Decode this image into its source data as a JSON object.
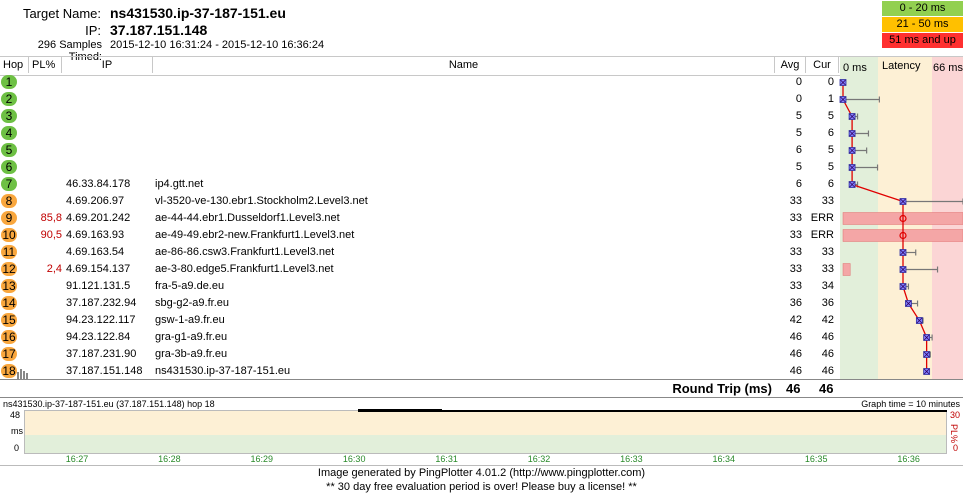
{
  "header": {
    "target_label": "Target Name:",
    "target_value": "ns431530.ip-37-187-151.eu",
    "ip_label": "IP:",
    "ip_value": "37.187.151.148",
    "samples_label": "296 Samples Timed:",
    "samples_value": "2015-12-10 16:31:24 - 2015-12-10 16:36:24"
  },
  "legend": [
    {
      "label": "0 - 20 ms",
      "color": "#92d050"
    },
    {
      "label": "21 - 50 ms",
      "color": "#ffc000"
    },
    {
      "label": "51 ms and up",
      "color": "#ff3030"
    }
  ],
  "columns": {
    "hop": "Hop",
    "pl": "PL%",
    "ip": "IP",
    "name": "Name",
    "avg": "Avg",
    "cur": "Cur",
    "graph_min": "0 ms",
    "graph_title": "Latency",
    "graph_max": "66 ms"
  },
  "hops": [
    {
      "hop": "1",
      "pl": "",
      "ip": "",
      "name": "",
      "avg": "0",
      "cur": "0",
      "color": "#6ec044",
      "lat": 0,
      "err_lo": 0,
      "err_hi": 1
    },
    {
      "hop": "2",
      "pl": "",
      "ip": "",
      "name": "",
      "avg": "0",
      "cur": "1",
      "color": "#6ec044",
      "lat": 0,
      "err_lo": 0,
      "err_hi": 20
    },
    {
      "hop": "3",
      "pl": "",
      "ip": "",
      "name": "",
      "avg": "5",
      "cur": "5",
      "color": "#6ec044",
      "lat": 5,
      "err_lo": 4,
      "err_hi": 8
    },
    {
      "hop": "4",
      "pl": "",
      "ip": "",
      "name": "",
      "avg": "5",
      "cur": "6",
      "color": "#6ec044",
      "lat": 5,
      "err_lo": 4,
      "err_hi": 14
    },
    {
      "hop": "5",
      "pl": "",
      "ip": "",
      "name": "",
      "avg": "6",
      "cur": "5",
      "color": "#6ec044",
      "lat": 5,
      "err_lo": 4,
      "err_hi": 13
    },
    {
      "hop": "6",
      "pl": "",
      "ip": "",
      "name": "",
      "avg": "5",
      "cur": "5",
      "color": "#6ec044",
      "lat": 5,
      "err_lo": 4,
      "err_hi": 19
    },
    {
      "hop": "7",
      "pl": "",
      "ip": "46.33.84.178",
      "name": "ip4.gtt.net",
      "avg": "6",
      "cur": "6",
      "color": "#6ec044",
      "lat": 5,
      "err_lo": 4,
      "err_hi": 8
    },
    {
      "hop": "8",
      "pl": "",
      "ip": "4.69.206.97",
      "name": "vl-3520-ve-130.ebr1.Stockholm2.Level3.net",
      "avg": "33",
      "cur": "33",
      "color": "#f9a73e",
      "lat": 33,
      "err_lo": 32,
      "err_hi": 66
    },
    {
      "hop": "9",
      "pl": "85,8",
      "ip": "4.69.201.242",
      "name": "ae-44-44.ebr1.Dusseldorf1.Level3.net",
      "avg": "33",
      "cur": "ERR",
      "color": "#f9a73e",
      "lat": 33,
      "err_lo": 33,
      "err_hi": 33,
      "loss": 1
    },
    {
      "hop": "10",
      "pl": "90,5",
      "ip": "4.69.163.93",
      "name": "ae-49-49.ebr2-new.Frankfurt1.Level3.net",
      "avg": "33",
      "cur": "ERR",
      "color": "#f9a73e",
      "lat": 33,
      "err_lo": 33,
      "err_hi": 33,
      "loss": 1
    },
    {
      "hop": "11",
      "pl": "",
      "ip": "4.69.163.54",
      "name": "ae-86-86.csw3.Frankfurt1.Level3.net",
      "avg": "33",
      "cur": "33",
      "color": "#f9a73e",
      "lat": 33,
      "err_lo": 32,
      "err_hi": 40
    },
    {
      "hop": "12",
      "pl": "2,4",
      "ip": "4.69.154.137",
      "name": "ae-3-80.edge5.Frankfurt1.Level3.net",
      "avg": "33",
      "cur": "33",
      "color": "#f9a73e",
      "lat": 33,
      "err_lo": 32,
      "err_hi": 52,
      "loss": 0.06
    },
    {
      "hop": "13",
      "pl": "",
      "ip": "91.121.131.5",
      "name": "fra-5-a9.de.eu",
      "avg": "33",
      "cur": "34",
      "color": "#f9a73e",
      "lat": 33,
      "err_lo": 32,
      "err_hi": 36
    },
    {
      "hop": "14",
      "pl": "",
      "ip": "37.187.232.94",
      "name": "sbg-g2-a9.fr.eu",
      "avg": "36",
      "cur": "36",
      "color": "#f9a73e",
      "lat": 36,
      "err_lo": 35,
      "err_hi": 41
    },
    {
      "hop": "15",
      "pl": "",
      "ip": "94.23.122.117",
      "name": "gsw-1-a9.fr.eu",
      "avg": "42",
      "cur": "42",
      "color": "#f9a73e",
      "lat": 42,
      "err_lo": 41,
      "err_hi": 44
    },
    {
      "hop": "16",
      "pl": "",
      "ip": "94.23.122.84",
      "name": "gra-g1-a9.fr.eu",
      "avg": "46",
      "cur": "46",
      "color": "#f9a73e",
      "lat": 46,
      "err_lo": 45,
      "err_hi": 49
    },
    {
      "hop": "17",
      "pl": "",
      "ip": "37.187.231.90",
      "name": "gra-3b-a9.fr.eu",
      "avg": "46",
      "cur": "46",
      "color": "#f9a73e",
      "lat": 46,
      "err_lo": 45,
      "err_hi": 48
    },
    {
      "hop": "18",
      "pl": "",
      "ip": "37.187.151.148",
      "name": "ns431530.ip-37-187-151.eu",
      "avg": "46",
      "cur": "46",
      "color": "#f9a73e",
      "lat": 46,
      "err_lo": 45,
      "err_hi": 47
    }
  ],
  "round_trip": {
    "label": "Round Trip (ms)",
    "avg": "46",
    "cur": "46"
  },
  "timeline": {
    "title": "ns431530.ip-37-187-151.eu (37.187.151.148) hop 18",
    "graph_time": "Graph time = 10 minutes",
    "y_top": "48",
    "y_mid": "ms",
    "y_bottom": "0",
    "pl_top": "30",
    "pl_label": "PL%",
    "pl_bottom": "0",
    "ticks": [
      "16:27",
      "16:28",
      "16:29",
      "16:30",
      "16:31",
      "16:32",
      "16:33",
      "16:34",
      "16:35",
      "16:36"
    ]
  },
  "footer": {
    "line1": "Image generated by PingPlotter 4.01.2 (http://www.pingplotter.com)",
    "line2": "** 30 day free evaluation period is over!  Please buy a license! **"
  }
}
